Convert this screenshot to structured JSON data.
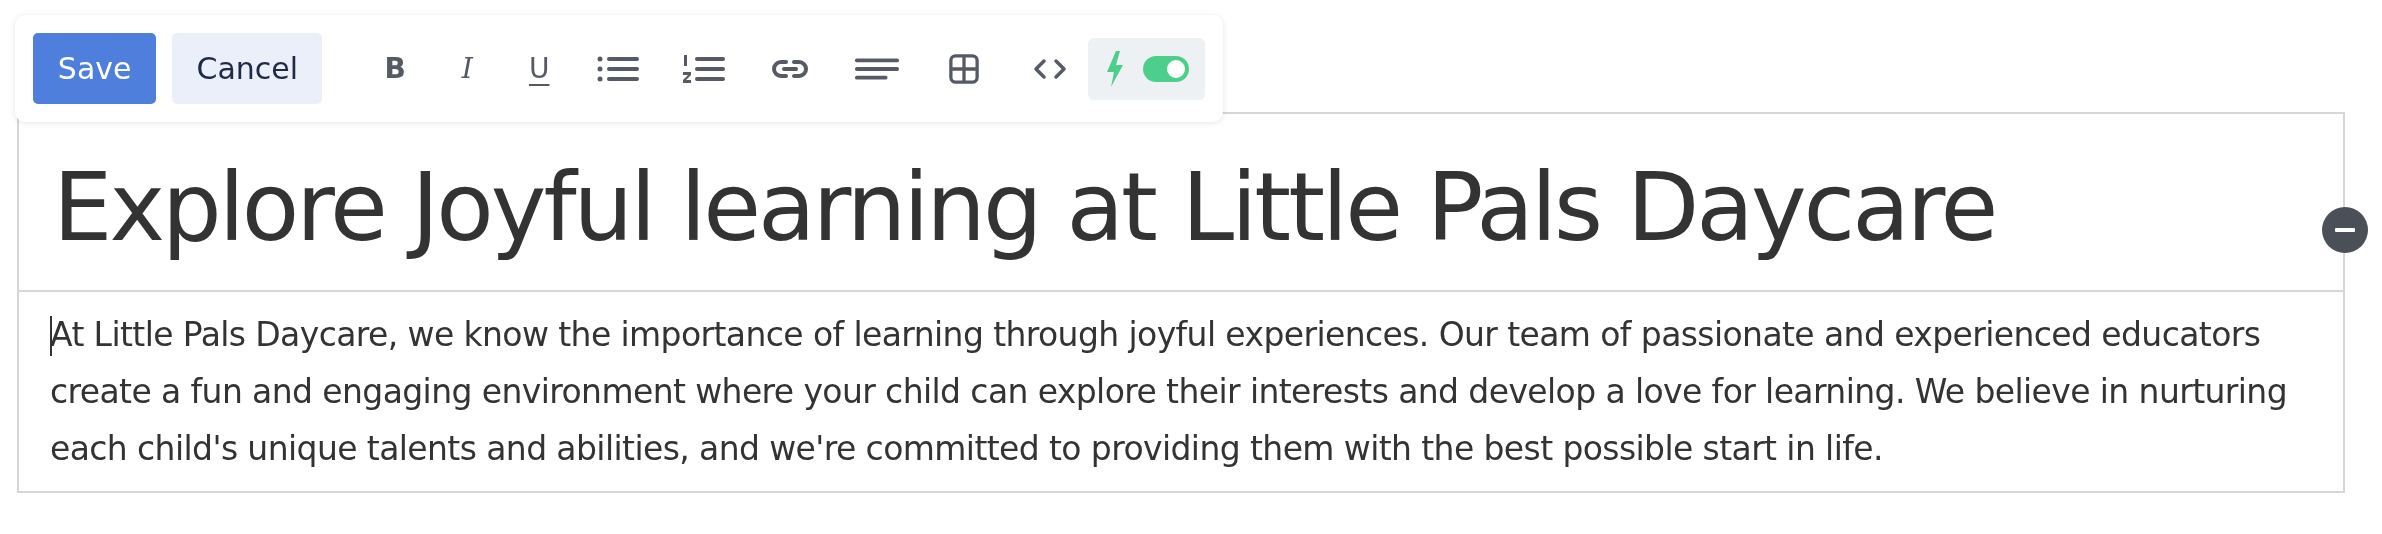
{
  "toolbar": {
    "save": "Save",
    "cancel": "Cancel",
    "tools": [
      {
        "kind": "bold",
        "label": "B"
      },
      {
        "kind": "italic",
        "label": "I"
      },
      {
        "kind": "underline",
        "label": "U"
      },
      {
        "kind": "bullets"
      },
      {
        "kind": "numbers"
      },
      {
        "kind": "link"
      },
      {
        "kind": "align"
      },
      {
        "kind": "table"
      },
      {
        "kind": "code"
      }
    ],
    "toggle": {
      "on": true
    }
  },
  "title": "Explore Joyful learning at Little Pals Daycare",
  "paragraph": "At Little Pals Daycare, we know the importance of learning through joyful experiences. Our team of passionate and experienced educators create a fun and engaging environment where your child can explore their interests and develop a love for learning. We believe in nurturing each child's unique talents and abilities, and we're committed to providing them with the best possible start in life."
}
